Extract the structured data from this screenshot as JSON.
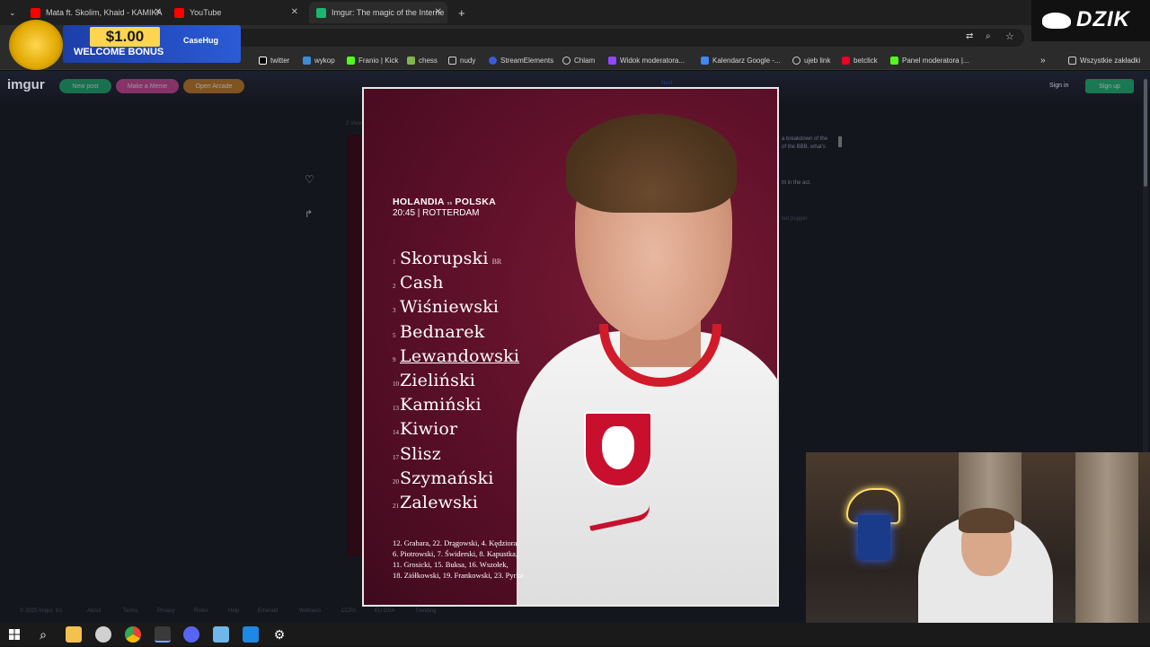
{
  "browser": {
    "tabs": [
      {
        "label": "Mata ft. Skolim, Khaid - KAMIKA",
        "color": "#ff0000",
        "active": false
      },
      {
        "label": "YouTube",
        "color": "#ff0000",
        "active": false
      },
      {
        "label": "Imgur: The magic of the Interne",
        "color": "#1bb76e",
        "active": true
      }
    ],
    "new_tab": "+",
    "bookmarks": [
      {
        "label": "twitter",
        "color": "#ffffff"
      },
      {
        "label": "wykop",
        "color": "#3c8dd6"
      },
      {
        "label": "Franio | Kick",
        "color": "#53fc18"
      },
      {
        "label": "chess",
        "color": "#81b64c"
      },
      {
        "label": "nudy",
        "color": "#cfcfcf"
      },
      {
        "label": "StreamElements",
        "color": "#3b5bdb"
      },
      {
        "label": "Chlam",
        "color": "#cfcfcf"
      },
      {
        "label": "Widok moderatora...",
        "color": "#9146ff"
      },
      {
        "label": "Kalendarz Google -...",
        "color": "#4285f4"
      },
      {
        "label": "ujeb link",
        "color": "#cfcfcf"
      },
      {
        "label": "betclick",
        "color": "#e5002b"
      },
      {
        "label": "Panel moderatora |...",
        "color": "#53fc18"
      }
    ],
    "bookmarks_more": "»",
    "all_bookmarks": "Wszystkie zakładki"
  },
  "imgur": {
    "logo": "imgur",
    "new_post": "New post",
    "make_meme": "Make a Meme",
    "open_arcade": "Open Arcade",
    "sign_in": "Sign in",
    "sign_up": "Sign up",
    "next": "Next",
    "side_text_1": "a breakdown of the",
    "side_text_2": "of the BBB, what's",
    "side_text_3": "ht in the act.",
    "side_text_4": "ted pupper",
    "views": "2 Views",
    "footer": [
      "© 2025 Imgur, Inc",
      "About",
      "Terms",
      "Privacy",
      "Rules",
      "Help",
      "Emerald",
      "Wellness",
      "CCPA",
      "EU DSA",
      "Trending"
    ]
  },
  "poster": {
    "match_home": "HOLANDIA",
    "match_vs": "vs",
    "match_away": "POLSKA",
    "time_place": "20:45 | ROTTERDAM",
    "lineup": [
      {
        "num": "1",
        "name": "Skorupski",
        "tag": "BR"
      },
      {
        "num": "2",
        "name": "Cash",
        "tag": ""
      },
      {
        "num": "3",
        "name": "Wiśniewski",
        "tag": ""
      },
      {
        "num": "5",
        "name": "Bednarek",
        "tag": ""
      },
      {
        "num": "9",
        "name": "Lewandowski",
        "tag": ""
      },
      {
        "num": "10",
        "name": "Zieliński",
        "tag": ""
      },
      {
        "num": "13",
        "name": "Kamiński",
        "tag": ""
      },
      {
        "num": "14",
        "name": "Kiwior",
        "tag": ""
      },
      {
        "num": "17",
        "name": "Slisz",
        "tag": ""
      },
      {
        "num": "20",
        "name": "Szymański",
        "tag": ""
      },
      {
        "num": "21",
        "name": "Zalewski",
        "tag": ""
      }
    ],
    "subs": [
      "12. Grabara, 22. Drągowski, 4. Kędziora,",
      "6. Piotrowski, 7. Świderski, 8. Kapustka,",
      "11. Grosicki, 15. Buksa, 16. Wszołek,",
      "18. Ziółkowski, 19. Frankowski, 23. Pyrka"
    ]
  },
  "overlays": {
    "promo_amount": "$1.00",
    "promo_text": "WELCOME BONUS",
    "promo_brand": "CaseHug",
    "streamer_logo": "DZIK"
  }
}
